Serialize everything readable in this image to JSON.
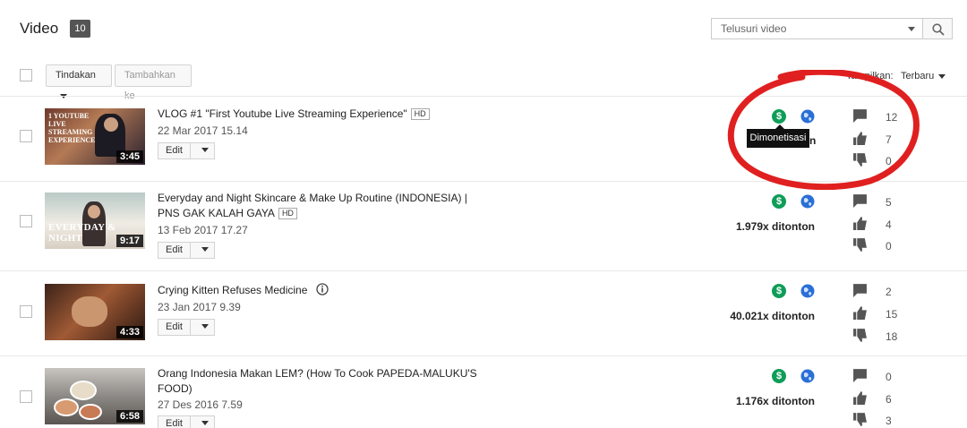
{
  "header": {
    "title": "Video",
    "count": "10"
  },
  "search": {
    "placeholder": "Telusuri video"
  },
  "toolbar": {
    "actions_label": "Tindakan",
    "add_to_label": "Tambahkan ke"
  },
  "sort": {
    "label": "Tampilkan:",
    "value": "Terbaru"
  },
  "tooltip": {
    "text": "Dimonetisasi"
  },
  "colors": {
    "monetized": "#0f9d58",
    "globe": "#2a6fd6",
    "annotation": "#e02020"
  },
  "videos": [
    {
      "title": "VLOG #1 \"First Youtube Live Streaming Experience\"",
      "hd": "HD",
      "date": "22 Mar 2017 15.14",
      "duration": "3:45",
      "thumb_text": "1 YOUTUBE LIVE STREAMING EXPERIENCE",
      "views": "",
      "comments": "12",
      "likes": "7",
      "dislikes": "0",
      "edit_label": "Edit"
    },
    {
      "title": "Everyday and Night Skincare & Make Up Routine (INDONESIA) | PNS GAK KALAH GAYA",
      "hd": "HD",
      "date": "13 Feb 2017 17.27",
      "duration": "9:17",
      "thumb_text": "EVERYDAY & NIGHT",
      "views": "1.979x ditonton",
      "comments": "5",
      "likes": "4",
      "dislikes": "0",
      "edit_label": "Edit"
    },
    {
      "title": "Crying Kitten Refuses Medicine",
      "hd": "",
      "date": "23 Jan 2017 9.39",
      "duration": "4:33",
      "thumb_text": "",
      "views": "40.021x ditonton",
      "comments": "2",
      "likes": "15",
      "dislikes": "18",
      "edit_label": "Edit"
    },
    {
      "title": "Orang Indonesia Makan LEM? (How To Cook PAPEDA-MALUKU'S FOOD)",
      "hd": "",
      "date": "27 Des 2016 7.59",
      "duration": "6:58",
      "thumb_text": "",
      "views": "1.176x ditonton",
      "comments": "0",
      "likes": "6",
      "dislikes": "3",
      "edit_label": "Edit"
    }
  ]
}
